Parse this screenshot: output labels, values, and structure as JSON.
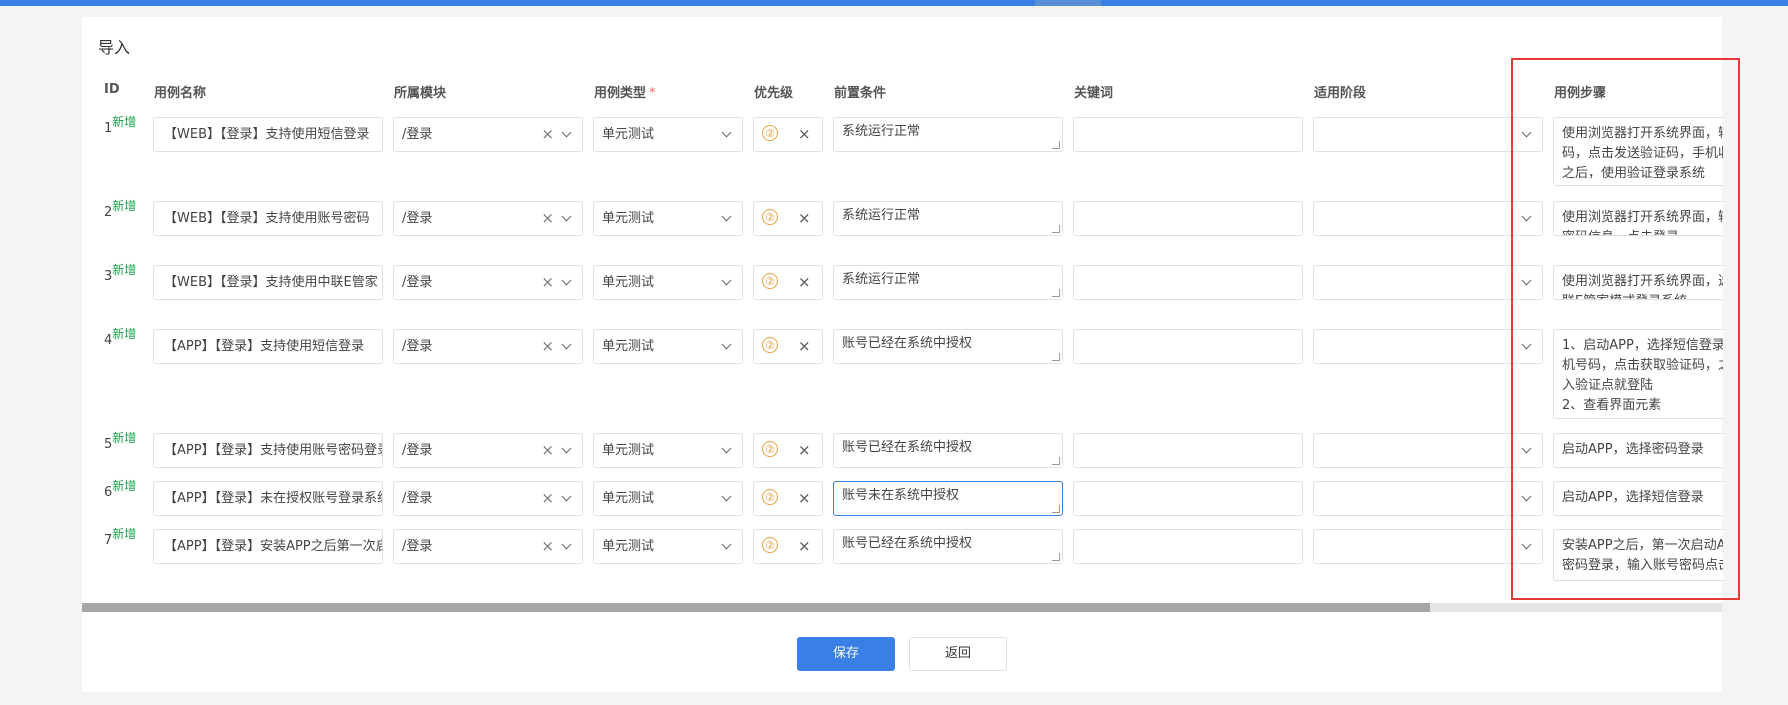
{
  "title": "导入",
  "headers": {
    "id": "ID",
    "name": "用例名称",
    "module": "所属模块",
    "type": "用例类型",
    "type_required": "*",
    "priority": "优先级",
    "precondition": "前置条件",
    "keyword": "关键词",
    "stage": "适用阶段",
    "steps": "用例步骤"
  },
  "rows": [
    {
      "id": "1",
      "tag": "新增",
      "name": "【WEB】【登录】支持使用短信登录",
      "module": "/登录",
      "type": "单元测试",
      "priority": "②",
      "precondition": "系统运行正常",
      "keyword": "",
      "stage": "",
      "steps": "使用浏览器打开系统界面，输\n码，点击发送验证码，手机收\n之后，使用验证登录系统"
    },
    {
      "id": "2",
      "tag": "新增",
      "name": "【WEB】【登录】支持使用账号密码",
      "module": "/登录",
      "type": "单元测试",
      "priority": "②",
      "precondition": "系统运行正常",
      "keyword": "",
      "stage": "",
      "steps": "使用浏览器打开系统界面，输\n密码信息，点击登录"
    },
    {
      "id": "3",
      "tag": "新增",
      "name": "【WEB】【登录】支持使用中联E管家",
      "module": "/登录",
      "type": "单元测试",
      "priority": "②",
      "precondition": "系统运行正常",
      "keyword": "",
      "stage": "",
      "steps": "使用浏览器打开系统界面，选\n联E管家模式登录系统"
    },
    {
      "id": "4",
      "tag": "新增",
      "name": "【APP】【登录】支持使用短信登录",
      "module": "/登录",
      "type": "单元测试",
      "priority": "②",
      "precondition": "账号已经在系统中授权",
      "keyword": "",
      "stage": "",
      "steps": "1、启动APP，选择短信登录\n机号码，点击获取验证码，之\n入验证点就登陆\n2、查看界面元素"
    },
    {
      "id": "5",
      "tag": "新增",
      "name": "【APP】【登录】支持使用账号密码登录",
      "module": "/登录",
      "type": "单元测试",
      "priority": "②",
      "precondition": "账号已经在系统中授权",
      "keyword": "",
      "stage": "",
      "steps": "启动APP，选择密码登录"
    },
    {
      "id": "6",
      "tag": "新增",
      "name": "【APP】【登录】未在授权账号登录系统",
      "module": "/登录",
      "type": "单元测试",
      "priority": "②",
      "precondition": "账号未在系统中授权",
      "keyword": "",
      "stage": "",
      "steps": "启动APP，选择短信登录"
    },
    {
      "id": "7",
      "tag": "新增",
      "name": "【APP】【登录】安装APP之后第一次启动",
      "module": "/登录",
      "type": "单元测试",
      "priority": "②",
      "precondition": "账号已经在系统中授权",
      "keyword": "",
      "stage": "",
      "steps": "安装APP之后，第一次启动A\n密码登录，输入账号密码点击"
    }
  ],
  "buttons": {
    "save": "保存",
    "back": "返回"
  },
  "colors": {
    "primary": "#3a7fe6",
    "tag": "#16a34a",
    "priority": "#e7a13a",
    "highlight_box": "#e53935"
  }
}
